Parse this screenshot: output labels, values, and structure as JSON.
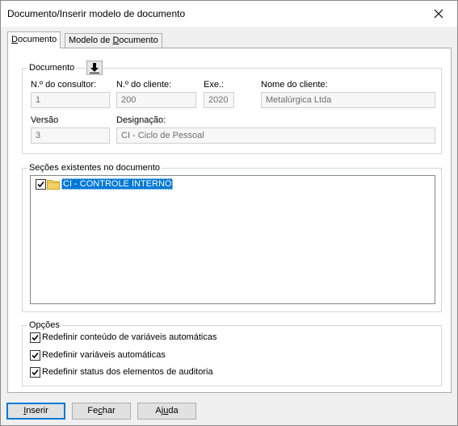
{
  "window": {
    "title": "Documento/Inserir modelo de documento"
  },
  "tabs": [
    {
      "label_pre": "",
      "label_u": "D",
      "label_post": "ocumento"
    },
    {
      "label_pre": "Modelo de ",
      "label_u": "D",
      "label_post": "ocumento"
    }
  ],
  "documento": {
    "legend": "Documento",
    "consultor": {
      "label": "N.º do consultor:",
      "value": "1"
    },
    "cliente_num": {
      "label": "N.º do cliente:",
      "value": "200"
    },
    "exe": {
      "label": "Exe.:",
      "value": "2020"
    },
    "cliente_nome": {
      "label": "Nome do cliente:",
      "value": "Metalúrgica Ltda"
    },
    "versao": {
      "label": "Versão",
      "value": "3"
    },
    "designacao": {
      "label": "Designação:",
      "value": "CI - Ciclo de Pessoal"
    }
  },
  "secoes": {
    "legend": "Seções existentes no documento",
    "items": [
      {
        "label": "CI - CONTROLE INTERNO",
        "checked": true
      }
    ]
  },
  "opcoes": {
    "legend": "Opções",
    "items": [
      {
        "label": "Redefinir conteúdo de variáveis automáticas",
        "checked": true
      },
      {
        "label": "Redefinir variáveis automáticas",
        "checked": true
      },
      {
        "label": "Redefinir status dos elementos de auditoria",
        "checked": true
      }
    ]
  },
  "buttons": {
    "inserir": {
      "u": "I",
      "rest": "nserir"
    },
    "fechar": {
      "pre": "Fe",
      "u": "c",
      "rest": "har"
    },
    "ajuda": {
      "pre": "Aj",
      "u": "u",
      "rest": "da"
    }
  },
  "colors": {
    "selection": "#0078d7",
    "folder": "#f5d062",
    "accent": "#0078d7"
  },
  "icons": [
    "close-icon",
    "download-arrow-icon",
    "checkbox-checked-icon",
    "folder-icon"
  ]
}
